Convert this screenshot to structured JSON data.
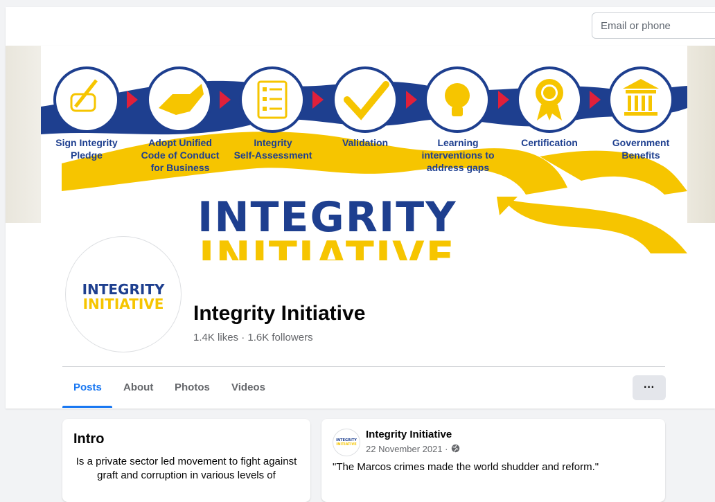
{
  "header": {
    "login_placeholder": "Email or phone"
  },
  "cover": {
    "steps": [
      {
        "label": "Sign Integrity\nPledge",
        "icon": "pen-hand-icon"
      },
      {
        "label": "Adopt Unified\nCode of Conduct\nfor Business",
        "icon": "handshake-icon"
      },
      {
        "label": "Integrity\nSelf-Assessment",
        "icon": "checklist-icon"
      },
      {
        "label": "Validation",
        "icon": "checkmark-icon"
      },
      {
        "label": "Learning\ninterventions to\naddress gaps",
        "icon": "lightbulb-icon"
      },
      {
        "label": "Certification",
        "icon": "medal-icon"
      },
      {
        "label": "Government\nBenefits",
        "icon": "government-building-icon"
      }
    ],
    "logo_top": "INTEGRITY",
    "logo_bottom": "INITIATIVE"
  },
  "avatar": {
    "word_top": "INTEGRITY",
    "word_bottom": "INITIATIVE"
  },
  "profile": {
    "name": "Integrity Initiative",
    "stats": "1.4K likes · 1.6K followers"
  },
  "tabs": [
    {
      "label": "Posts",
      "active": true
    },
    {
      "label": "About",
      "active": false
    },
    {
      "label": "Photos",
      "active": false
    },
    {
      "label": "Videos",
      "active": false
    }
  ],
  "more_button_label": "···",
  "intro": {
    "title": "Intro",
    "text": "Is a private sector led movement to fight against graft and corruption in various levels of"
  },
  "post": {
    "author": "Integrity Initiative",
    "date": "22 November 2021 ·",
    "text": "\"The Marcos crimes made the world shudder and reform.\""
  },
  "colors": {
    "navy": "#1e3f8f",
    "gold": "#f6c500",
    "red_arrow": "#e0203a",
    "link_blue": "#1877f2"
  }
}
